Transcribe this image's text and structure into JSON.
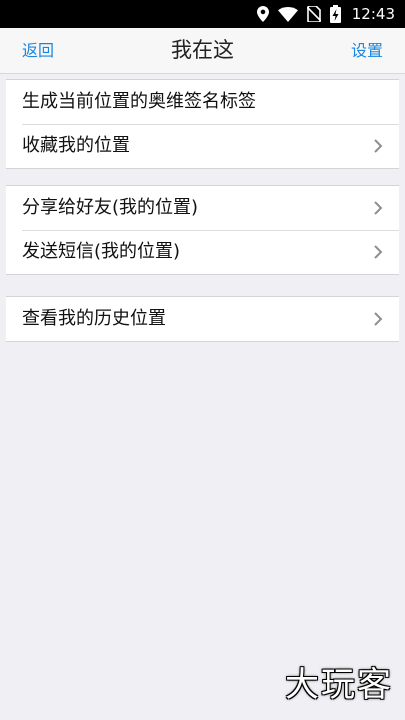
{
  "status_bar": {
    "time": "12:43",
    "icons": [
      "location-icon",
      "wifi-icon",
      "no-sim-icon",
      "battery-charging-icon"
    ]
  },
  "nav": {
    "back_label": "返回",
    "title": "我在这",
    "settings_label": "设置"
  },
  "groups": [
    {
      "items": [
        {
          "label": "生成当前位置的奥维签名标签",
          "chevron": false
        },
        {
          "label": "收藏我的位置",
          "chevron": true
        }
      ]
    },
    {
      "items": [
        {
          "label": "分享给好友(我的位置)",
          "chevron": true
        },
        {
          "label": "发送短信(我的位置)",
          "chevron": true
        }
      ]
    },
    {
      "items": [
        {
          "label": "查看我的历史位置",
          "chevron": true
        }
      ]
    }
  ],
  "watermark": "大玩客",
  "colors": {
    "accent": "#1a86e0",
    "background": "#efeff4",
    "chevron": "#8e8e93"
  }
}
